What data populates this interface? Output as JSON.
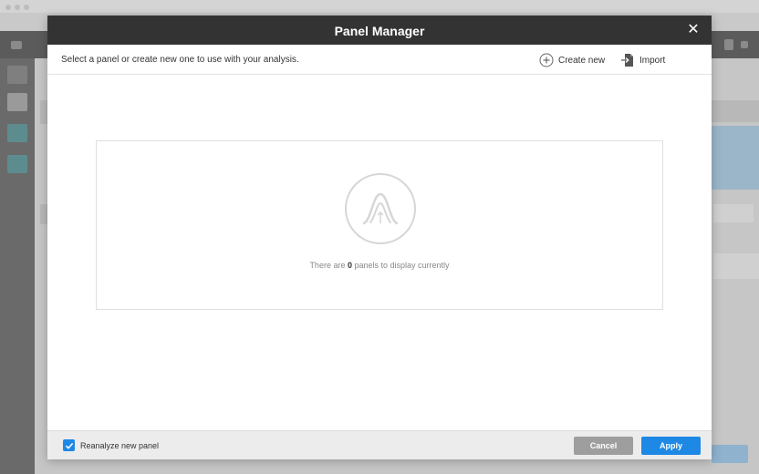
{
  "modal": {
    "title": "Panel Manager",
    "close_icon": "close-icon"
  },
  "toolbar": {
    "instructions": "Select a panel or create new one to use with your analysis.",
    "create_label": "Create new",
    "create_icon": "plus-circle-icon",
    "import_label": "Import",
    "import_icon": "import-file-icon"
  },
  "empty_state": {
    "icon": "peak-histogram-icon",
    "text_before": "There are ",
    "count": "0",
    "text_after": " panels to display currently"
  },
  "footer": {
    "reanalyze_label": "Reanalyze new panel",
    "reanalyze_checked": true,
    "cancel_label": "Cancel",
    "apply_label": "Apply"
  },
  "colors": {
    "titlebar": "#333333",
    "primary": "#1e88e5",
    "cancel": "#9e9e9e",
    "footer_bg": "#ececec"
  }
}
